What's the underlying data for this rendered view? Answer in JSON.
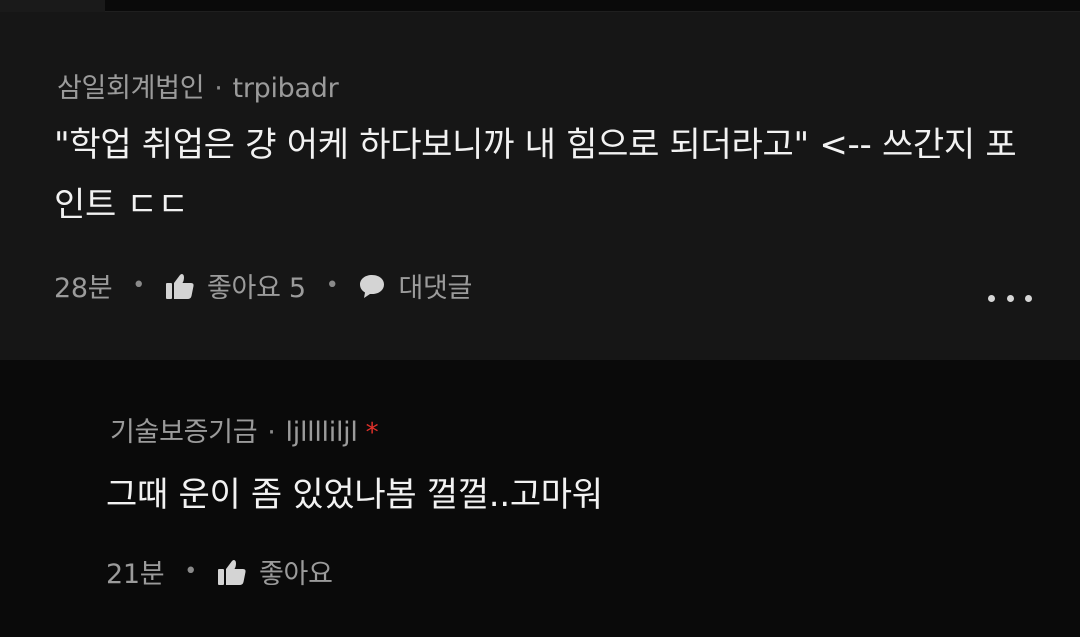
{
  "comment": {
    "author": "삼일회계법인",
    "separator": "·",
    "handle": "trpibadr",
    "body": "\"학업 취업은 걍 어케 하다보니까 내 힘으로 되더라고\" <-- 쓰간지 포인트 ㄷㄷ",
    "time": "28분",
    "like_label": "좋아요 5",
    "reply_label": "대댓글",
    "icons": [
      "thumbs-up-icon",
      "speech-bubble-icon",
      "more-dots-icon"
    ]
  },
  "reply": {
    "author": "기술보증기금",
    "separator": "·",
    "handle": "ljlllliljl",
    "badge": "*",
    "body": "그때 운이 좀 있었나봄 껄껄..고마워",
    "time": "21분",
    "like_label": "좋아요",
    "icons": [
      "thumbs-up-icon"
    ]
  },
  "colors": {
    "background": "#0a0a0a",
    "comment_card": "#161616",
    "text_primary": "#f2f2f2",
    "text_secondary": "#9b9b9b",
    "author_badge": "#e2312a"
  }
}
